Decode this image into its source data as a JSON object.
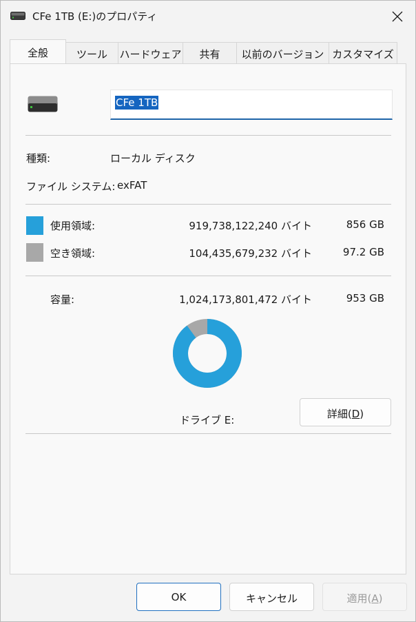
{
  "window": {
    "title": "CFe 1TB (E:)のプロパティ"
  },
  "tabs": [
    {
      "label": "全般"
    },
    {
      "label": "ツール"
    },
    {
      "label": "ハードウェア"
    },
    {
      "label": "共有"
    },
    {
      "label": "以前のバージョン"
    },
    {
      "label": "カスタマイズ"
    }
  ],
  "general": {
    "drive_name": "CFe 1TB",
    "type_label": "種類:",
    "type_value": "ローカル ディスク",
    "fs_label": "ファイル システム:",
    "fs_value": "exFAT",
    "used_label": "使用領域:",
    "used_bytes": "919,738,122,240 バイト",
    "used_size": "856 GB",
    "free_label": "空き領域:",
    "free_bytes": "104,435,679,232 バイト",
    "free_size": "97.2 GB",
    "capacity_label": "容量:",
    "capacity_bytes": "1,024,173,801,472 バイト",
    "capacity_size": "953 GB",
    "drive_label": "ドライブ E:",
    "details_button": "詳細",
    "details_mnemonic": "D",
    "used_fraction": 0.898,
    "used_color": "#26a0da",
    "free_color": "#a8a8a8"
  },
  "footer": {
    "ok": "OK",
    "cancel": "キャンセル",
    "apply": "適用",
    "apply_mnemonic": "A"
  }
}
